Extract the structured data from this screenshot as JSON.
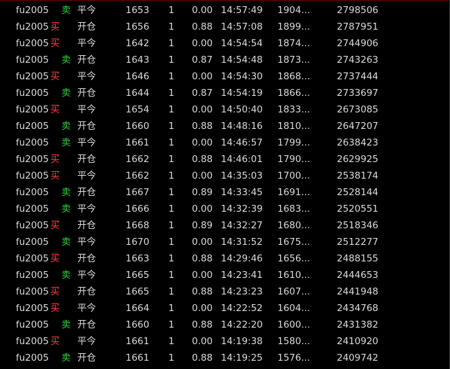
{
  "colors": {
    "buy": "#ff4040",
    "sell": "#2fcf3a",
    "text": "#dcdcdc",
    "background": "#000000"
  },
  "trades": [
    {
      "symbol": "fu2005",
      "side": "卖",
      "action": "平今",
      "price": "1653",
      "qty": "1",
      "pnl": "0.00",
      "time": "14:57:49",
      "value": "1904...",
      "id": "2798506"
    },
    {
      "symbol": "fu2005",
      "side": "买",
      "action": "开仓",
      "price": "1656",
      "qty": "1",
      "pnl": "0.88",
      "time": "14:57:08",
      "value": "1899...",
      "id": "2787951"
    },
    {
      "symbol": "fu2005",
      "side": "买",
      "action": "平今",
      "price": "1642",
      "qty": "1",
      "pnl": "0.00",
      "time": "14:54:54",
      "value": "1874...",
      "id": "2744906"
    },
    {
      "symbol": "fu2005",
      "side": "卖",
      "action": "开仓",
      "price": "1643",
      "qty": "1",
      "pnl": "0.87",
      "time": "14:54:48",
      "value": "1873...",
      "id": "2743263"
    },
    {
      "symbol": "fu2005",
      "side": "买",
      "action": "平今",
      "price": "1646",
      "qty": "1",
      "pnl": "0.00",
      "time": "14:54:30",
      "value": "1868...",
      "id": "2737444"
    },
    {
      "symbol": "fu2005",
      "side": "卖",
      "action": "开仓",
      "price": "1644",
      "qty": "1",
      "pnl": "0.87",
      "time": "14:54:19",
      "value": "1866...",
      "id": "2733697"
    },
    {
      "symbol": "fu2005",
      "side": "买",
      "action": "平今",
      "price": "1654",
      "qty": "1",
      "pnl": "0.00",
      "time": "14:50:40",
      "value": "1833...",
      "id": "2673085"
    },
    {
      "symbol": "fu2005",
      "side": "卖",
      "action": "开仓",
      "price": "1660",
      "qty": "1",
      "pnl": "0.88",
      "time": "14:48:16",
      "value": "1810...",
      "id": "2647207"
    },
    {
      "symbol": "fu2005",
      "side": "卖",
      "action": "平今",
      "price": "1661",
      "qty": "1",
      "pnl": "0.00",
      "time": "14:46:57",
      "value": "1799...",
      "id": "2638423"
    },
    {
      "symbol": "fu2005",
      "side": "买",
      "action": "开仓",
      "price": "1662",
      "qty": "1",
      "pnl": "0.88",
      "time": "14:46:01",
      "value": "1790...",
      "id": "2629925"
    },
    {
      "symbol": "fu2005",
      "side": "买",
      "action": "平今",
      "price": "1662",
      "qty": "1",
      "pnl": "0.00",
      "time": "14:35:03",
      "value": "1700...",
      "id": "2538174"
    },
    {
      "symbol": "fu2005",
      "side": "卖",
      "action": "开仓",
      "price": "1667",
      "qty": "1",
      "pnl": "0.89",
      "time": "14:33:45",
      "value": "1691...",
      "id": "2528144"
    },
    {
      "symbol": "fu2005",
      "side": "卖",
      "action": "平今",
      "price": "1666",
      "qty": "1",
      "pnl": "0.00",
      "time": "14:32:39",
      "value": "1683...",
      "id": "2520551"
    },
    {
      "symbol": "fu2005",
      "side": "买",
      "action": "开仓",
      "price": "1668",
      "qty": "1",
      "pnl": "0.89",
      "time": "14:32:27",
      "value": "1680...",
      "id": "2518346"
    },
    {
      "symbol": "fu2005",
      "side": "卖",
      "action": "平今",
      "price": "1670",
      "qty": "1",
      "pnl": "0.00",
      "time": "14:31:52",
      "value": "1675...",
      "id": "2512277"
    },
    {
      "symbol": "fu2005",
      "side": "买",
      "action": "开仓",
      "price": "1663",
      "qty": "1",
      "pnl": "0.88",
      "time": "14:29:46",
      "value": "1656...",
      "id": "2488155"
    },
    {
      "symbol": "fu2005",
      "side": "卖",
      "action": "平今",
      "price": "1665",
      "qty": "1",
      "pnl": "0.00",
      "time": "14:23:41",
      "value": "1610...",
      "id": "2444653"
    },
    {
      "symbol": "fu2005",
      "side": "买",
      "action": "开仓",
      "price": "1665",
      "qty": "1",
      "pnl": "0.88",
      "time": "14:23:23",
      "value": "1607...",
      "id": "2441948"
    },
    {
      "symbol": "fu2005",
      "side": "买",
      "action": "平今",
      "price": "1664",
      "qty": "1",
      "pnl": "0.00",
      "time": "14:22:52",
      "value": "1604...",
      "id": "2434768"
    },
    {
      "symbol": "fu2005",
      "side": "卖",
      "action": "开仓",
      "price": "1660",
      "qty": "1",
      "pnl": "0.88",
      "time": "14:22:20",
      "value": "1600...",
      "id": "2431382"
    },
    {
      "symbol": "fu2005",
      "side": "买",
      "action": "平今",
      "price": "1661",
      "qty": "1",
      "pnl": "0.00",
      "time": "14:19:38",
      "value": "1580...",
      "id": "2410920"
    },
    {
      "symbol": "fu2005",
      "side": "卖",
      "action": "开仓",
      "price": "1661",
      "qty": "1",
      "pnl": "0.88",
      "time": "14:19:25",
      "value": "1576...",
      "id": "2409742"
    }
  ]
}
